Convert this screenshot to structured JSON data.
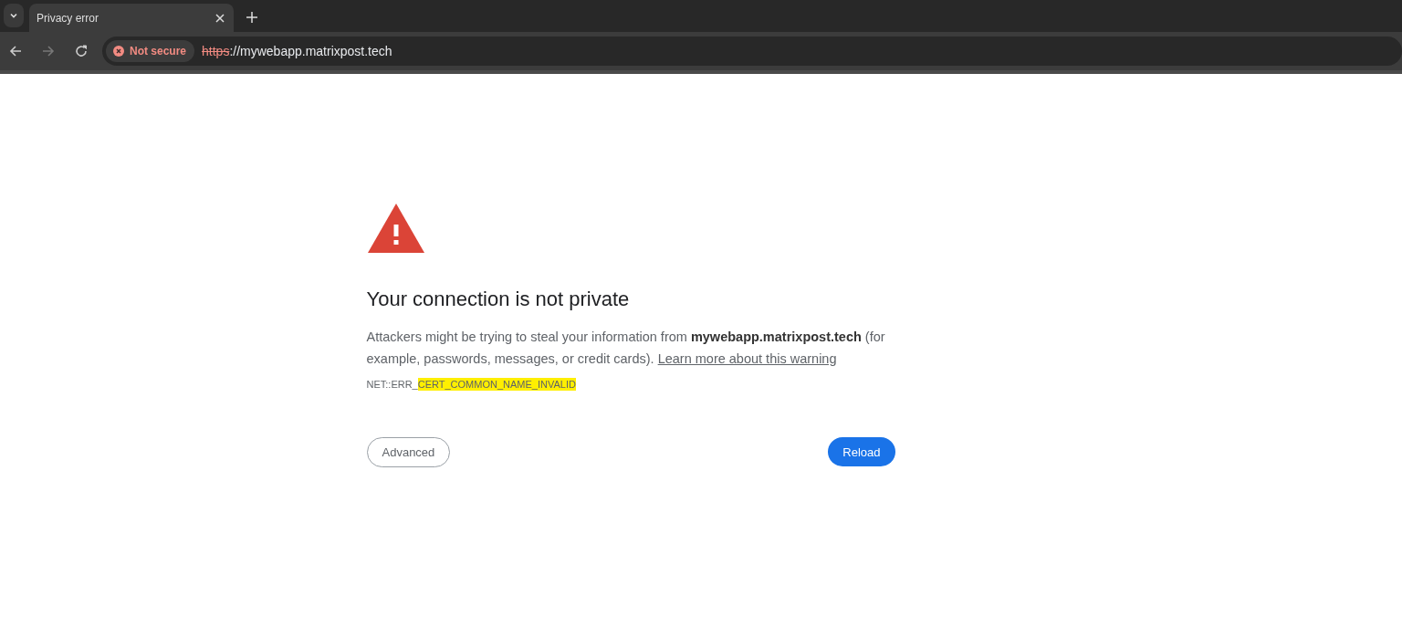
{
  "tabs": [
    {
      "title": "Privacy error",
      "selected": true
    }
  ],
  "address_bar": {
    "security_label": "Not secure",
    "scheme": "https",
    "rest": "://mywebapp.matrixpost.tech"
  },
  "heading": "Your connection is not private",
  "message": {
    "text": "Attackers might be trying to steal your information from **mywebapp.matrixpost.tech** (for example, passwords, messages, or credit cards).",
    "link": "Learn more about this warning"
  },
  "error_code": {
    "prefix": "NET::ERR_",
    "highlighted": "CERT_COMMON_NAME_INVALID"
  },
  "buttons": [
    {
      "label": "Advanced",
      "kind": "secondary"
    },
    {
      "label": "Reload",
      "kind": "primary"
    }
  ]
}
